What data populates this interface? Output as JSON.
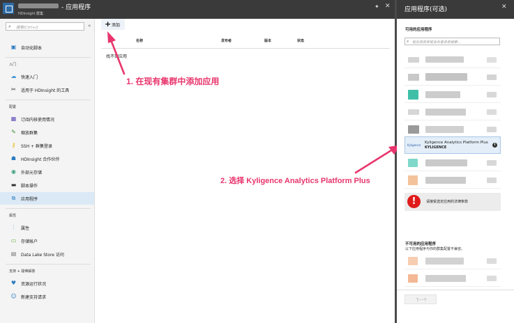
{
  "header": {
    "title": "- 应用程序",
    "subtitle": "HDInsight 群集",
    "pin_glyph": "✦",
    "close_glyph": "✕"
  },
  "search": {
    "placeholder": "搜索(Ctrl+/)",
    "icon": "search-icon"
  },
  "sidebar": {
    "collapse_glyph": "«",
    "items": [
      {
        "label": "自动化脚本",
        "icon": "automation-icon",
        "color": "#2d7cc1"
      },
      {
        "label": "快速入门",
        "icon": "quickstart-icon",
        "color": "#3a90d6"
      },
      {
        "label": "适用于 HDInsight 的工具",
        "icon": "tools-icon",
        "color": "#333333"
      },
      {
        "label": "订阅内核使用情况",
        "icon": "grid-icon",
        "color": "#5b4bb7"
      },
      {
        "label": "缩放群集",
        "icon": "edit-icon",
        "color": "#3c8d3c"
      },
      {
        "label": "SSH + 群集登录",
        "icon": "key-icon",
        "color": "#e8b400"
      },
      {
        "label": "HDInsight 合作伙伴",
        "icon": "partner-icon",
        "color": "#2d7cc1"
      },
      {
        "label": "外部元存储",
        "icon": "database-icon",
        "color": "#3aa07a"
      },
      {
        "label": "脚本操作",
        "icon": "script-icon",
        "color": "#333333"
      },
      {
        "label": "应用程序",
        "icon": "apps-icon",
        "color": "#2d7cc1"
      },
      {
        "label": "属性",
        "icon": "properties-icon",
        "color": "#2d7cc1"
      },
      {
        "label": "存储帐户",
        "icon": "storage-icon",
        "color": "#5fae3a"
      },
      {
        "label": "Data Lake Store 访问",
        "icon": "datalake-icon",
        "color": "#777777"
      },
      {
        "label": "资源运行状况",
        "icon": "health-icon",
        "color": "#2d7cc1"
      },
      {
        "label": "新建支持请求",
        "icon": "support-icon",
        "color": "#2d7cc1"
      }
    ],
    "sections": [
      "入门",
      "配置",
      "属性",
      "支持 + 疑难解答"
    ]
  },
  "main": {
    "add_label": "添加",
    "columns": [
      "名称",
      "发布者",
      "版本",
      "状态"
    ],
    "empty_text": "找不到应用"
  },
  "annotations": {
    "step1": "1. 在现有集群中添加应用",
    "step2": "2. 选择 Kyligence Analytics Platform Plus",
    "color": "#e8356d"
  },
  "right_panel": {
    "title": "应用程序(可选)",
    "available_heading": "可用的应用程序",
    "search_placeholder": "按应用名称或发布者名称搜索...",
    "selected_app": {
      "name": "Kyligence Analytics Platform Plus",
      "publisher": "KYLIGENCE",
      "logo_text": "Kyligence"
    },
    "legal_text": "请接受选定应用的法律条款",
    "unavailable_heading": "不可用的应用程序",
    "unavailable_note": "以下应用程序与你的群集配置不兼容。",
    "next_label": "下一个"
  }
}
